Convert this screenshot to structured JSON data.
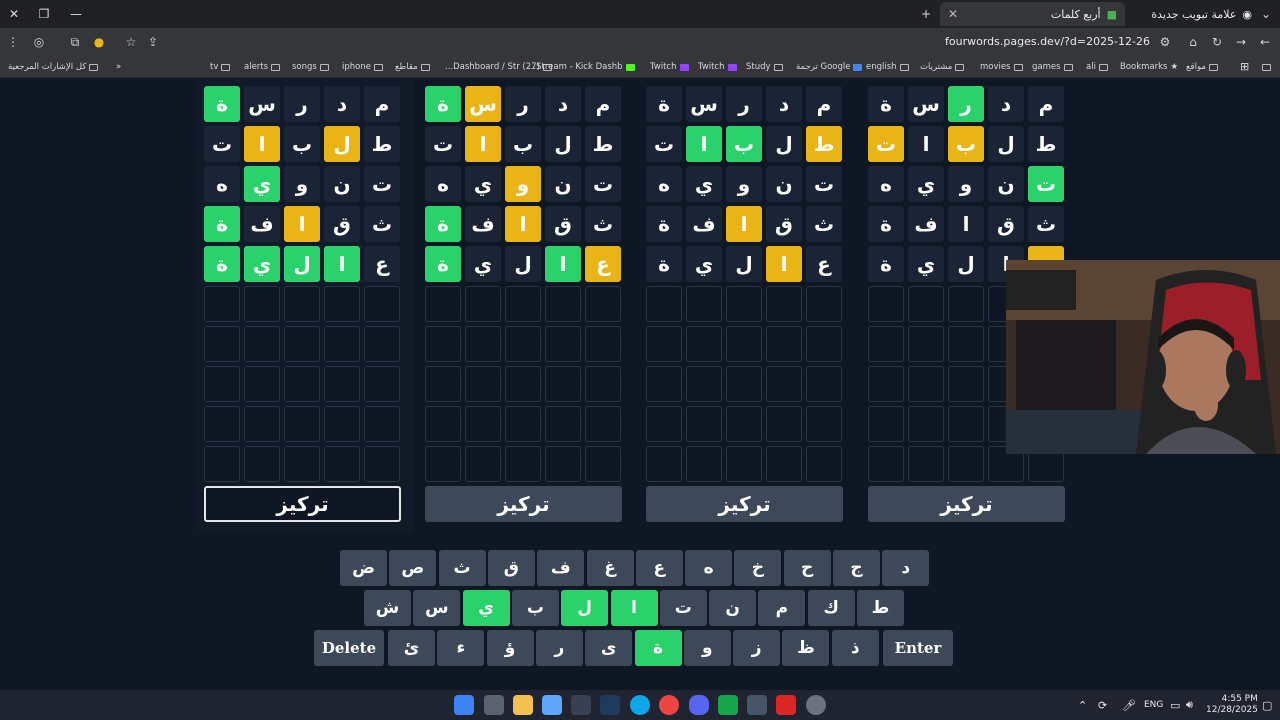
{
  "browser": {
    "tabs": [
      {
        "title": "أربع كلمات",
        "active": true
      },
      {
        "title": "علامة تبويب جديدة",
        "active": false
      }
    ],
    "url": "fourwords.pages.dev/?d=2025-12-26",
    "bookmarks": [
      "كل الإشارات المرجعية",
      "tv",
      "alerts",
      "songs",
      "iphone",
      "مقاطع",
      "(27) Dashboard / Str...",
      "Stream - Kick Dashb...",
      "Twitch",
      "Twitch",
      "Study",
      "Google ترجمة",
      "english",
      "مشتريات",
      "movies",
      "games",
      "ali",
      "Bookmarks",
      "مواقع"
    ]
  },
  "boards": [
    {
      "rows": [
        {
          "letters": [
            "ة",
            "س",
            "ر",
            "د",
            "م"
          ],
          "colors": [
            "g",
            "n",
            "n",
            "n",
            "n"
          ]
        },
        {
          "letters": [
            "ت",
            "ا",
            "ب",
            "ل",
            "ط"
          ],
          "colors": [
            "n",
            "y",
            "n",
            "y",
            "n"
          ]
        },
        {
          "letters": [
            "ه",
            "ي",
            "و",
            "ن",
            "ت"
          ],
          "colors": [
            "n",
            "g",
            "n",
            "n",
            "n"
          ]
        },
        {
          "letters": [
            "ة",
            "ف",
            "ا",
            "ق",
            "ث"
          ],
          "colors": [
            "g",
            "n",
            "y",
            "n",
            "n"
          ]
        },
        {
          "letters": [
            "ة",
            "ي",
            "ل",
            "ا",
            "ع"
          ],
          "colors": [
            "g",
            "g",
            "g",
            "g",
            "n"
          ]
        }
      ],
      "focus_label": "تركيز",
      "focused": true
    },
    {
      "rows": [
        {
          "letters": [
            "ة",
            "س",
            "ر",
            "د",
            "م"
          ],
          "colors": [
            "g",
            "y",
            "n",
            "n",
            "n"
          ]
        },
        {
          "letters": [
            "ت",
            "ا",
            "ب",
            "ل",
            "ط"
          ],
          "colors": [
            "n",
            "y",
            "n",
            "n",
            "n"
          ]
        },
        {
          "letters": [
            "ه",
            "ي",
            "و",
            "ن",
            "ت"
          ],
          "colors": [
            "n",
            "n",
            "y",
            "n",
            "n"
          ]
        },
        {
          "letters": [
            "ة",
            "ف",
            "ا",
            "ق",
            "ث"
          ],
          "colors": [
            "g",
            "n",
            "y",
            "n",
            "n"
          ]
        },
        {
          "letters": [
            "ة",
            "ي",
            "ل",
            "ا",
            "ع"
          ],
          "colors": [
            "g",
            "n",
            "n",
            "g",
            "y"
          ]
        }
      ],
      "focus_label": "تركيز",
      "focused": false
    },
    {
      "rows": [
        {
          "letters": [
            "ة",
            "س",
            "ر",
            "د",
            "م"
          ],
          "colors": [
            "n",
            "n",
            "n",
            "n",
            "n"
          ]
        },
        {
          "letters": [
            "ت",
            "ا",
            "ب",
            "ل",
            "ط"
          ],
          "colors": [
            "n",
            "g",
            "g",
            "n",
            "y"
          ]
        },
        {
          "letters": [
            "ه",
            "ي",
            "و",
            "ن",
            "ت"
          ],
          "colors": [
            "n",
            "n",
            "n",
            "n",
            "n"
          ]
        },
        {
          "letters": [
            "ة",
            "ف",
            "ا",
            "ق",
            "ث"
          ],
          "colors": [
            "n",
            "n",
            "y",
            "n",
            "n"
          ]
        },
        {
          "letters": [
            "ة",
            "ي",
            "ل",
            "ا",
            "ع"
          ],
          "colors": [
            "n",
            "n",
            "n",
            "y",
            "n"
          ]
        }
      ],
      "focus_label": "تركيز",
      "focused": false
    },
    {
      "rows": [
        {
          "letters": [
            "ة",
            "س",
            "ر",
            "د",
            "م"
          ],
          "colors": [
            "n",
            "n",
            "g",
            "n",
            "n"
          ]
        },
        {
          "letters": [
            "ت",
            "ا",
            "ب",
            "ل",
            "ط"
          ],
          "colors": [
            "y",
            "n",
            "y",
            "n",
            "n"
          ]
        },
        {
          "letters": [
            "ه",
            "ي",
            "و",
            "ن",
            "ت"
          ],
          "colors": [
            "n",
            "n",
            "n",
            "n",
            "g"
          ]
        },
        {
          "letters": [
            "ة",
            "ف",
            "ا",
            "ق",
            "ث"
          ],
          "colors": [
            "n",
            "n",
            "n",
            "n",
            "n"
          ]
        },
        {
          "letters": [
            "ة",
            "ي",
            "ل",
            "ا",
            "ع"
          ],
          "colors": [
            "n",
            "n",
            "n",
            "n",
            "y"
          ]
        }
      ],
      "focus_label": "تركيز",
      "focused": false
    }
  ],
  "keyboard": {
    "row1": [
      {
        "k": "ض",
        "c": ""
      },
      {
        "k": "ص",
        "c": ""
      },
      {
        "k": "ث",
        "c": ""
      },
      {
        "k": "ق",
        "c": ""
      },
      {
        "k": "ف",
        "c": ""
      },
      {
        "k": "غ",
        "c": ""
      },
      {
        "k": "ع",
        "c": ""
      },
      {
        "k": "ه",
        "c": ""
      },
      {
        "k": "خ",
        "c": ""
      },
      {
        "k": "ح",
        "c": ""
      },
      {
        "k": "ج",
        "c": ""
      },
      {
        "k": "د",
        "c": ""
      }
    ],
    "row2": [
      {
        "k": "ش",
        "c": ""
      },
      {
        "k": "س",
        "c": ""
      },
      {
        "k": "ي",
        "c": "g"
      },
      {
        "k": "ب",
        "c": ""
      },
      {
        "k": "ل",
        "c": "g"
      },
      {
        "k": "ا",
        "c": "g"
      },
      {
        "k": "ت",
        "c": ""
      },
      {
        "k": "ن",
        "c": ""
      },
      {
        "k": "م",
        "c": ""
      },
      {
        "k": "ك",
        "c": ""
      },
      {
        "k": "ط",
        "c": ""
      }
    ],
    "row3": [
      {
        "k": "ئ",
        "c": ""
      },
      {
        "k": "ء",
        "c": ""
      },
      {
        "k": "ؤ",
        "c": ""
      },
      {
        "k": "ر",
        "c": ""
      },
      {
        "k": "ى",
        "c": ""
      },
      {
        "k": "ة",
        "c": "g"
      },
      {
        "k": "و",
        "c": ""
      },
      {
        "k": "ز",
        "c": ""
      },
      {
        "k": "ظ",
        "c": ""
      },
      {
        "k": "ذ",
        "c": ""
      }
    ],
    "delete_label": "Delete",
    "enter_label": "Enter"
  },
  "taskbar": {
    "lang": "ENG",
    "time": "4:55 PM",
    "date": "12/28/2025"
  }
}
